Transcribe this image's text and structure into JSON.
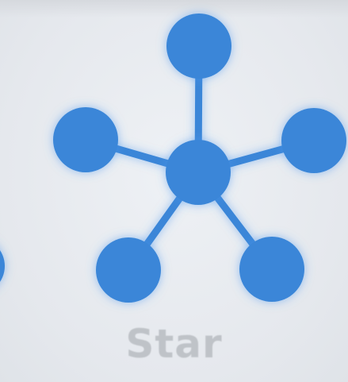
{
  "caption": "Star",
  "node_color": "#3a86d8",
  "glow_color": "#4a96ee",
  "caption_color": "#bfc3c8",
  "icons": {
    "hub": "hub-node-icon",
    "satellite": "satellite-node-icon"
  }
}
